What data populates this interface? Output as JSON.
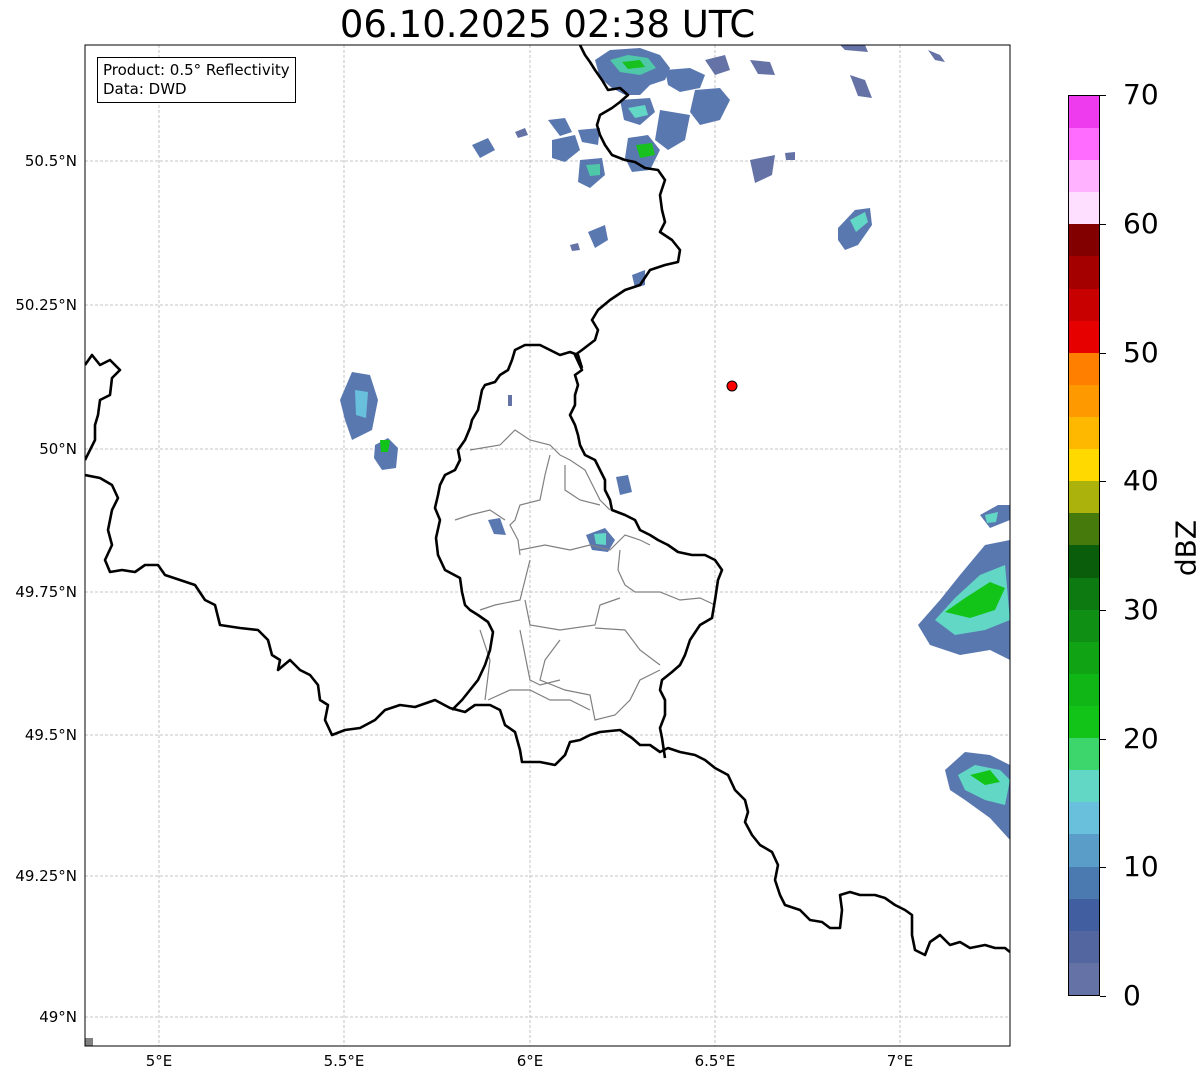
{
  "title": "06.10.2025 02:38 UTC",
  "infobox": {
    "product": "Product: 0.5° Reflectivity",
    "source": "Data: DWD"
  },
  "axes": {
    "lon_range": [
      4.8,
      7.3
    ],
    "lat_range": [
      48.95,
      50.7
    ],
    "x_ticks": [
      "5°E",
      "5.5°E",
      "6°E",
      "6.5°E",
      "7°E"
    ],
    "y_ticks": [
      "49°N",
      "49.25°N",
      "49.5°N",
      "49.75°N",
      "50°N",
      "50.25°N",
      "50.5°N"
    ],
    "grid": true
  },
  "marker": {
    "lon": 6.55,
    "lat": 50.11,
    "color": "#ff0000"
  },
  "colorbar": {
    "label": "dBZ",
    "ticks": [
      "0",
      "10",
      "20",
      "30",
      "40",
      "50",
      "60",
      "70"
    ],
    "min": 0,
    "max": 70,
    "colors": [
      "#6472a6",
      "#54669f",
      "#415ea1",
      "#4a7aaf",
      "#5a9dc8",
      "#68c0dc",
      "#63d7c6",
      "#3dd66d",
      "#12c418",
      "#10b615",
      "#10a414",
      "#0f8f14",
      "#0c7a10",
      "#0a5d0b",
      "#477a0c",
      "#aab20b",
      "#ffd900",
      "#ffb800",
      "#ff9900",
      "#ff7f00",
      "#e60000",
      "#c80000",
      "#a50000",
      "#820000",
      "#ffdfff",
      "#ffb2ff",
      "#ff6cff",
      "#ee3bee"
    ]
  },
  "legend_text": {}
}
